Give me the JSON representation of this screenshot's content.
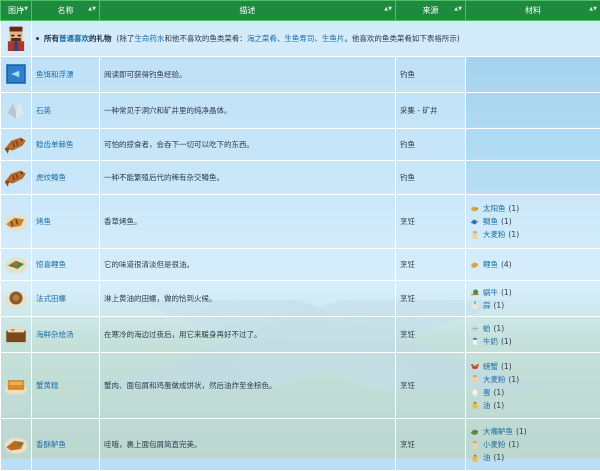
{
  "headers": {
    "image": "图片",
    "name": "名称",
    "desc": "描述",
    "source": "来源",
    "materials": "材料"
  },
  "note": {
    "pre_a": "所有",
    "pre_link": "普通喜欢",
    "pre_b": "的礼物",
    "mid": "(除了",
    "link1": "生命药水",
    "mid2": "和他不喜欢的鱼类菜肴：",
    "link2": "海之菜肴",
    "sep1": "、",
    "link3": "生鱼寿司",
    "sep2": "、",
    "link4": "生鱼片",
    "tail": "。他喜欢的鱼类菜肴如下表格所示)"
  },
  "rows": [
    {
      "name": "鱼饵和浮漂",
      "desc": "阅读即可获得钓鱼经验。",
      "source": "钓鱼",
      "icon": "book-icon",
      "materials": []
    },
    {
      "name": "石英",
      "desc": "一种常见于洞穴和矿井里的纯净晶体。",
      "source": "采集 - 矿井",
      "icon": "quartz-icon",
      "materials": []
    },
    {
      "name": "鲶齿单棘鱼",
      "desc": "可怕的掠食者，会吞下一切可以吃下的东西。",
      "source": "钓鱼",
      "icon": "fish-icon",
      "materials": []
    },
    {
      "name": "虎纹鳟鱼",
      "desc": "一种不能繁殖后代的稀有杂交鳟鱼。",
      "source": "钓鱼",
      "icon": "fish-icon",
      "materials": []
    },
    {
      "name": "烤鱼",
      "desc": "香草烤鱼。",
      "source": "烹饪",
      "icon": "grilled-fish-icon",
      "materials": [
        {
          "name": "太阳鱼",
          "qty": "(1)",
          "icon": "sunfish-icon"
        },
        {
          "name": "鲷鱼",
          "qty": "(1)",
          "icon": "bream-icon"
        },
        {
          "name": "大麦粉",
          "qty": "(1)",
          "icon": "flour-icon"
        }
      ]
    },
    {
      "name": "惊喜鲤鱼",
      "desc": "它的味道很清淡但是很油。",
      "source": "烹饪",
      "icon": "carp-dish-icon",
      "materials": [
        {
          "name": "鲤鱼",
          "qty": "(4)",
          "icon": "carp-icon"
        }
      ]
    },
    {
      "name": "法式田螺",
      "desc": "淋上黄油的田螺，做的恰到火候。",
      "source": "烹饪",
      "icon": "escargot-icon",
      "materials": [
        {
          "name": "蜗牛",
          "qty": "(1)",
          "icon": "snail-icon"
        },
        {
          "name": "蒜",
          "qty": "(1)",
          "icon": "garlic-icon"
        }
      ]
    },
    {
      "name": "海鲜杂烩汤",
      "desc": "在寒冷的海边过夜后，用它来暖身再好不过了。",
      "source": "烹饪",
      "icon": "chowder-icon",
      "materials": [
        {
          "name": "蛤",
          "qty": "(1)",
          "icon": "clam-icon"
        },
        {
          "name": "牛奶",
          "qty": "(1)",
          "icon": "milk-icon"
        }
      ]
    },
    {
      "name": "蟹黄糕",
      "desc": "蟹肉、面包屑和鸡蛋做成饼状，然后油炸至金棕色。",
      "source": "烹饪",
      "icon": "crab-cake-icon",
      "materials": [
        {
          "name": "螃蟹",
          "qty": "(1)",
          "icon": "crab-icon"
        },
        {
          "name": "大麦粉",
          "qty": "(1)",
          "icon": "flour-icon"
        },
        {
          "name": "蛋",
          "qty": "(1)",
          "icon": "egg-icon"
        },
        {
          "name": "油",
          "qty": "(1)",
          "icon": "oil-icon"
        }
      ]
    },
    {
      "name": "香酥鲈鱼",
      "desc": "哇哦，裹上面包屑简直完美。",
      "source": "烹饪",
      "icon": "crispy-bass-icon",
      "materials": [
        {
          "name": "大嘴鲈鱼",
          "qty": "(1)",
          "icon": "bass-icon"
        },
        {
          "name": "小麦粉",
          "qty": "(1)",
          "icon": "flour-icon"
        },
        {
          "name": "油",
          "qty": "(1)",
          "icon": "oil-icon"
        }
      ]
    }
  ]
}
